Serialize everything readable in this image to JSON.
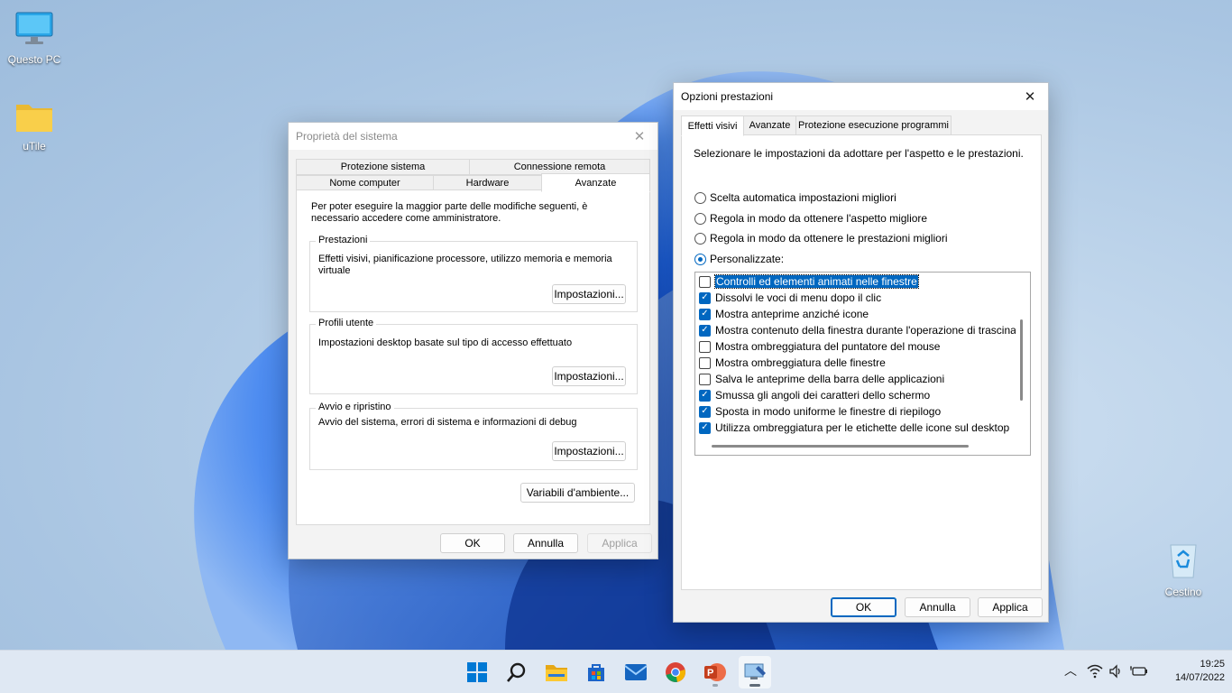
{
  "desktop": {
    "icons": [
      {
        "label": "Questo PC"
      },
      {
        "label": "uTile"
      },
      {
        "label": "Cestino"
      }
    ]
  },
  "system_properties": {
    "title": "Proprietà del sistema",
    "tabs_row1": [
      "Protezione sistema",
      "Connessione remota"
    ],
    "tabs_row2": [
      "Nome computer",
      "Hardware",
      "Avanzate"
    ],
    "active_tab": "Avanzate",
    "intro": "Per poter eseguire la maggior parte delle modifiche seguenti, è necessario accedere come amministratore.",
    "groups": [
      {
        "label": "Prestazioni",
        "text": "Effetti visivi, pianificazione processore, utilizzo memoria e memoria virtuale",
        "button": "Impostazioni..."
      },
      {
        "label": "Profili utente",
        "text": "Impostazioni desktop basate sul tipo di accesso effettuato",
        "button": "Impostazioni..."
      },
      {
        "label": "Avvio e ripristino",
        "text": "Avvio del sistema, errori di sistema e informazioni di debug",
        "button": "Impostazioni..."
      }
    ],
    "env_button": "Variabili d'ambiente...",
    "ok": "OK",
    "cancel": "Annulla",
    "apply": "Applica"
  },
  "performance_options": {
    "title": "Opzioni prestazioni",
    "tabs": [
      "Effetti visivi",
      "Avanzate",
      "Protezione esecuzione programmi"
    ],
    "active_tab": "Effetti visivi",
    "description": "Selezionare le impostazioni da adottare per l'aspetto e le prestazioni.",
    "radios": [
      {
        "label": "Scelta automatica impostazioni migliori",
        "selected": false
      },
      {
        "label": "Regola in modo da ottenere l'aspetto migliore",
        "selected": false
      },
      {
        "label": "Regola in modo da ottenere le prestazioni migliori",
        "selected": false
      },
      {
        "label": "Personalizzate:",
        "selected": true
      }
    ],
    "effects": [
      {
        "label": "Controlli ed elementi animati nelle finestre",
        "checked": false,
        "selected": true
      },
      {
        "label": "Dissolvi le voci di menu dopo il clic",
        "checked": true
      },
      {
        "label": "Mostra anteprime anziché icone",
        "checked": true
      },
      {
        "label": "Mostra contenuto della finestra durante l'operazione di trascina",
        "checked": true
      },
      {
        "label": "Mostra ombreggiatura del puntatore del mouse",
        "checked": false
      },
      {
        "label": "Mostra ombreggiatura delle finestre",
        "checked": false
      },
      {
        "label": "Salva le anteprime della barra delle applicazioni",
        "checked": false
      },
      {
        "label": "Smussa gli angoli dei caratteri dello schermo",
        "checked": true
      },
      {
        "label": "Sposta in modo uniforme le finestre di riepilogo",
        "checked": true
      },
      {
        "label": "Utilizza ombreggiatura per le etichette delle icone sul desktop",
        "checked": true
      }
    ],
    "ok": "OK",
    "cancel": "Annulla",
    "apply": "Applica"
  },
  "taskbar": {
    "apps": [
      "start-icon",
      "search-icon",
      "file-explorer-icon",
      "microsoft-store-icon",
      "mail-icon",
      "chrome-icon",
      "powerpoint-icon",
      "system-properties-icon"
    ],
    "time": "19:25",
    "date": "14/07/2022"
  },
  "colors": {
    "accent": "#0067c0",
    "taskbar": "#dfe8f3",
    "bloom": "#1e5fd8"
  }
}
